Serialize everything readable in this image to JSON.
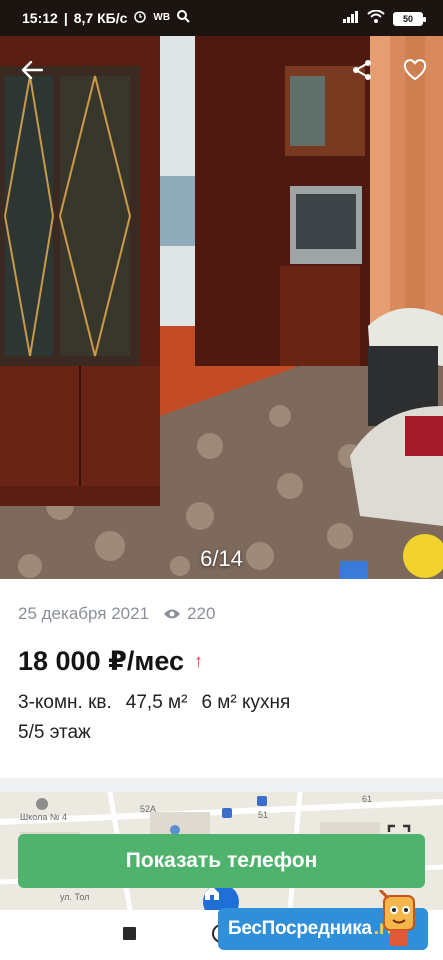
{
  "status_bar": {
    "time": "15:12",
    "network_speed": "8,7 КБ/с",
    "app_badge": "WB",
    "battery": "50"
  },
  "gallery": {
    "counter": "6/14"
  },
  "listing": {
    "date": "25 декабря 2021",
    "views": "220",
    "price": "18 000 ₽/мес",
    "price_trend": "↑",
    "rooms": "3-комн. кв.",
    "area": "47,5 м²",
    "kitchen": "6 м² кухня",
    "floor": "5/5 этаж"
  },
  "map": {
    "labels": [
      "Школа № 4",
      "52А",
      "51",
      "61",
      "ул. Тол"
    ]
  },
  "actions": {
    "show_phone": "Показать телефон"
  },
  "watermark": {
    "brand": "БесПосредника",
    "domain": ".ru"
  },
  "colors": {
    "accent_green": "#4fb36e",
    "trend_red": "#e8473a",
    "banner_blue": "#2f8fd8"
  }
}
